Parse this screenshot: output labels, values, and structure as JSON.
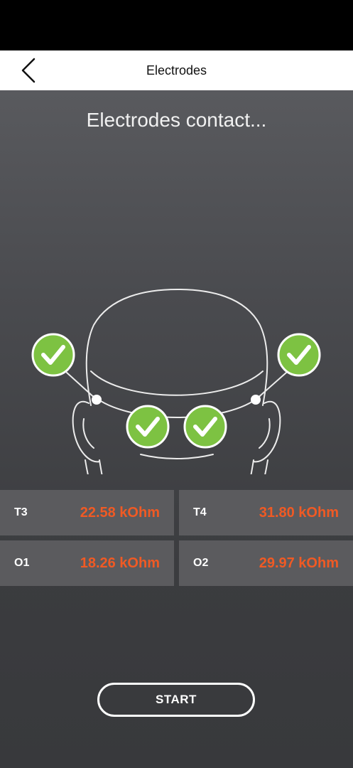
{
  "header": {
    "title": "Electrodes"
  },
  "main": {
    "headline": "Electrodes contact..."
  },
  "electrodes": [
    {
      "label": "T3",
      "value": "22.58 kOhm",
      "status": "ok"
    },
    {
      "label": "T4",
      "value": "31.80 kOhm",
      "status": "ok"
    },
    {
      "label": "O1",
      "value": "18.26 kOhm",
      "status": "ok"
    },
    {
      "label": "O2",
      "value": "29.97 kOhm",
      "status": "ok"
    }
  ],
  "actions": {
    "start_label": "START"
  },
  "colors": {
    "value": "#f05a24",
    "check": "#7dc242",
    "panel": "#5b5b5e"
  },
  "icons": {
    "back": "chevron-left-icon",
    "ok": "check-circle-icon"
  }
}
